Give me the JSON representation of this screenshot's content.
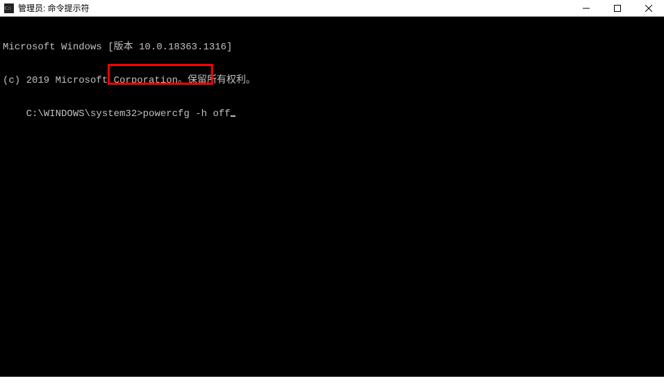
{
  "window": {
    "title": "管理员: 命令提示符",
    "icon_label": "C:\\"
  },
  "terminal": {
    "line1": "Microsoft Windows [版本 10.0.18363.1316]",
    "line2": "(c) 2019 Microsoft Corporation。保留所有权利。",
    "prompt": "C:\\WINDOWS\\system32>",
    "command": "powercfg -h off"
  }
}
